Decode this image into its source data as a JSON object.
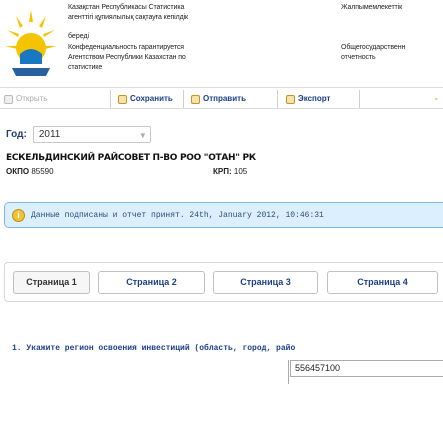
{
  "header": {
    "left_line1": "Казақстан Республикасы Статистика",
    "left_line2": "агенттігі құпиялылық сақтауға кепілдік",
    "left_line3": "береді",
    "left_line4": "Конфеденциальность гарантируется",
    "left_line5": "Агентством Республики Казахстан по",
    "left_line6": "статистике",
    "right_line1": "Жалпымемлекеттік",
    "right_line4": "Общегосударственн",
    "right_line5": "отчетность",
    "logo_icon": "kazstat-sun-logo",
    "logo_colors": {
      "sun": "#f5c400",
      "circle": "#1a78c2"
    }
  },
  "toolbar": {
    "open": "Открыть",
    "save": "Сохранить",
    "send": "Отправить",
    "export": "Экспорт",
    "more": "-"
  },
  "form": {
    "year_label": "Год:",
    "year_value": "2011",
    "org_name": "ЕСКЕЛЬДИНСКИЙ РАЙСОВЕТ П-ВО РОО \"ОТАН\" РК",
    "okpo_label": "ОКПО",
    "okpo_value": "85590",
    "kpp_label": "КРП:",
    "kpp_value": "105"
  },
  "status": {
    "message": "Данные подписаны и отчет принят. 24th, January 2012, 10:46:31",
    "color": "#dcefff"
  },
  "pages": {
    "tabs": [
      "Страница 1",
      "Страница 2",
      "Страница 3",
      "Страница 4"
    ],
    "active": 0
  },
  "question": {
    "text": "1. Укажите регион освоения инвестиций (область, город, райо",
    "answer": "556457100"
  }
}
